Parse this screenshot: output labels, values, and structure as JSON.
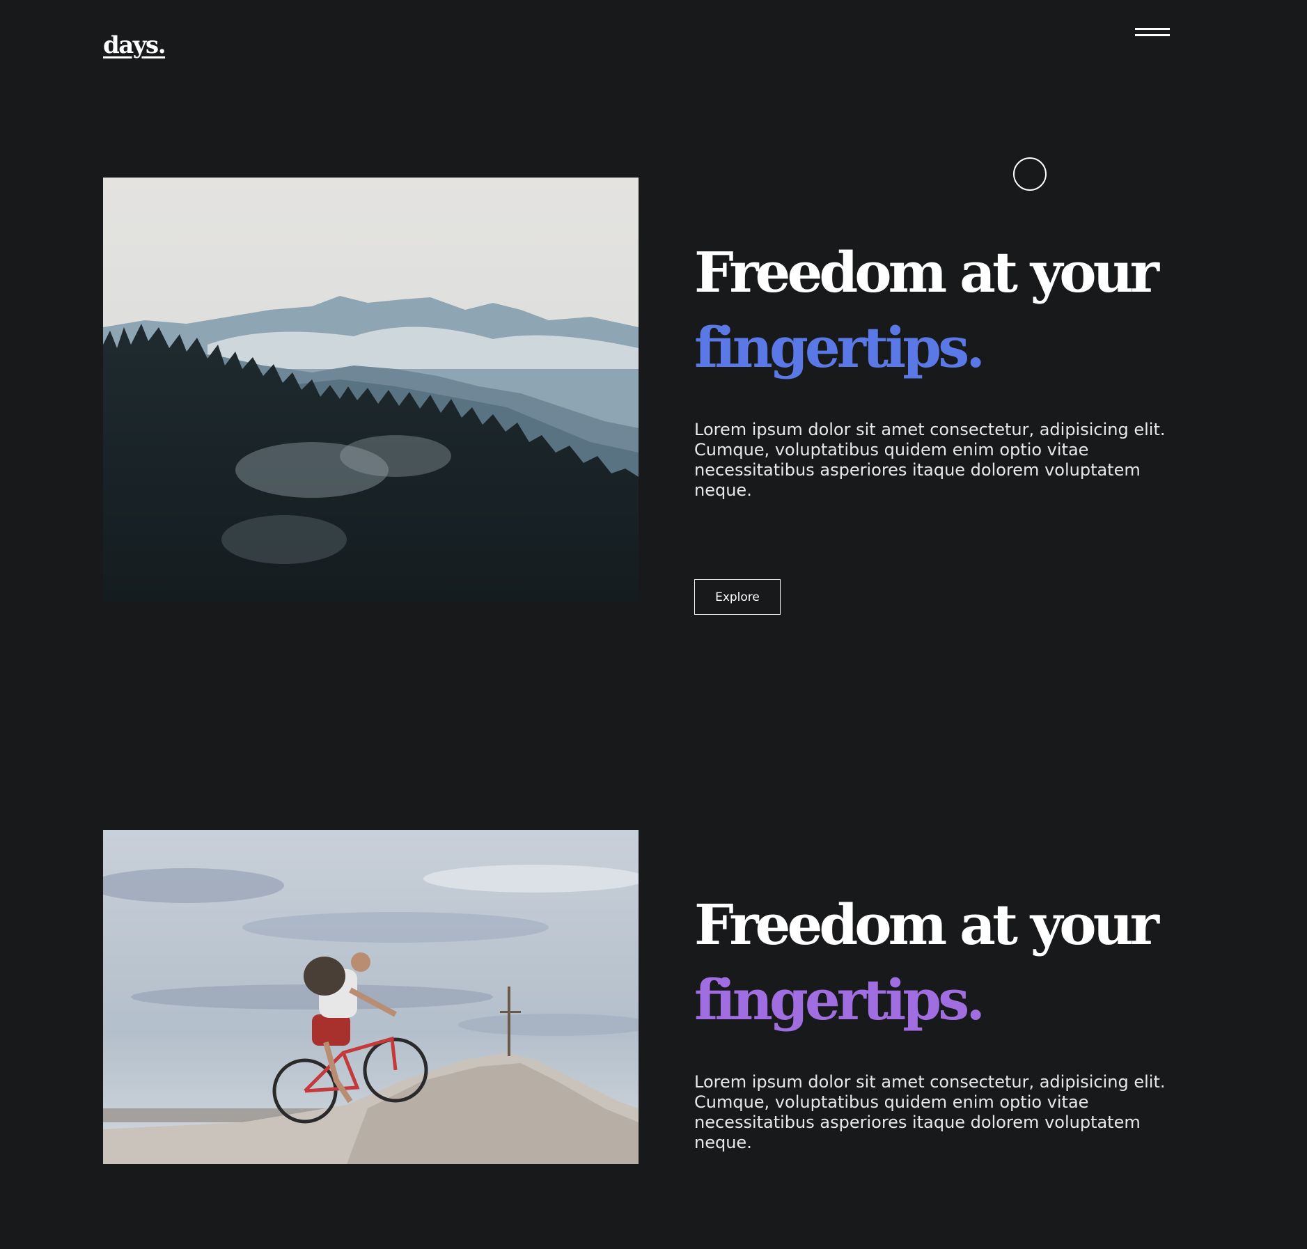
{
  "brand": {
    "logo": "days."
  },
  "nav": {
    "menu_icon": "hamburger-menu-icon"
  },
  "cursor": {
    "icon": "circle-cursor-icon"
  },
  "sections": [
    {
      "image": "misty-forest-mountains-photo",
      "headline_line1": "Freedom at your",
      "headline_accent": "fingertips.",
      "accent_color": "#5b79e6",
      "body": "Lorem ipsum dolor sit amet consectetur, adipisicing elit. Cumque, voluptatibus quidem enim optio vitae necessitatibus asperiores itaque dolorem voluptatem neque.",
      "button_label": "Explore"
    },
    {
      "image": "mountain-biker-summit-photo",
      "headline_line1": "Freedom at your",
      "headline_accent": "fingertips.",
      "accent_color": "#a06ee0",
      "body": "Lorem ipsum dolor sit amet consectetur, adipisicing elit. Cumque, voluptatibus quidem enim optio vitae necessitatibus asperiores itaque dolorem voluptatem neque."
    }
  ],
  "colors": {
    "background": "#18191b",
    "text": "#ffffff"
  }
}
